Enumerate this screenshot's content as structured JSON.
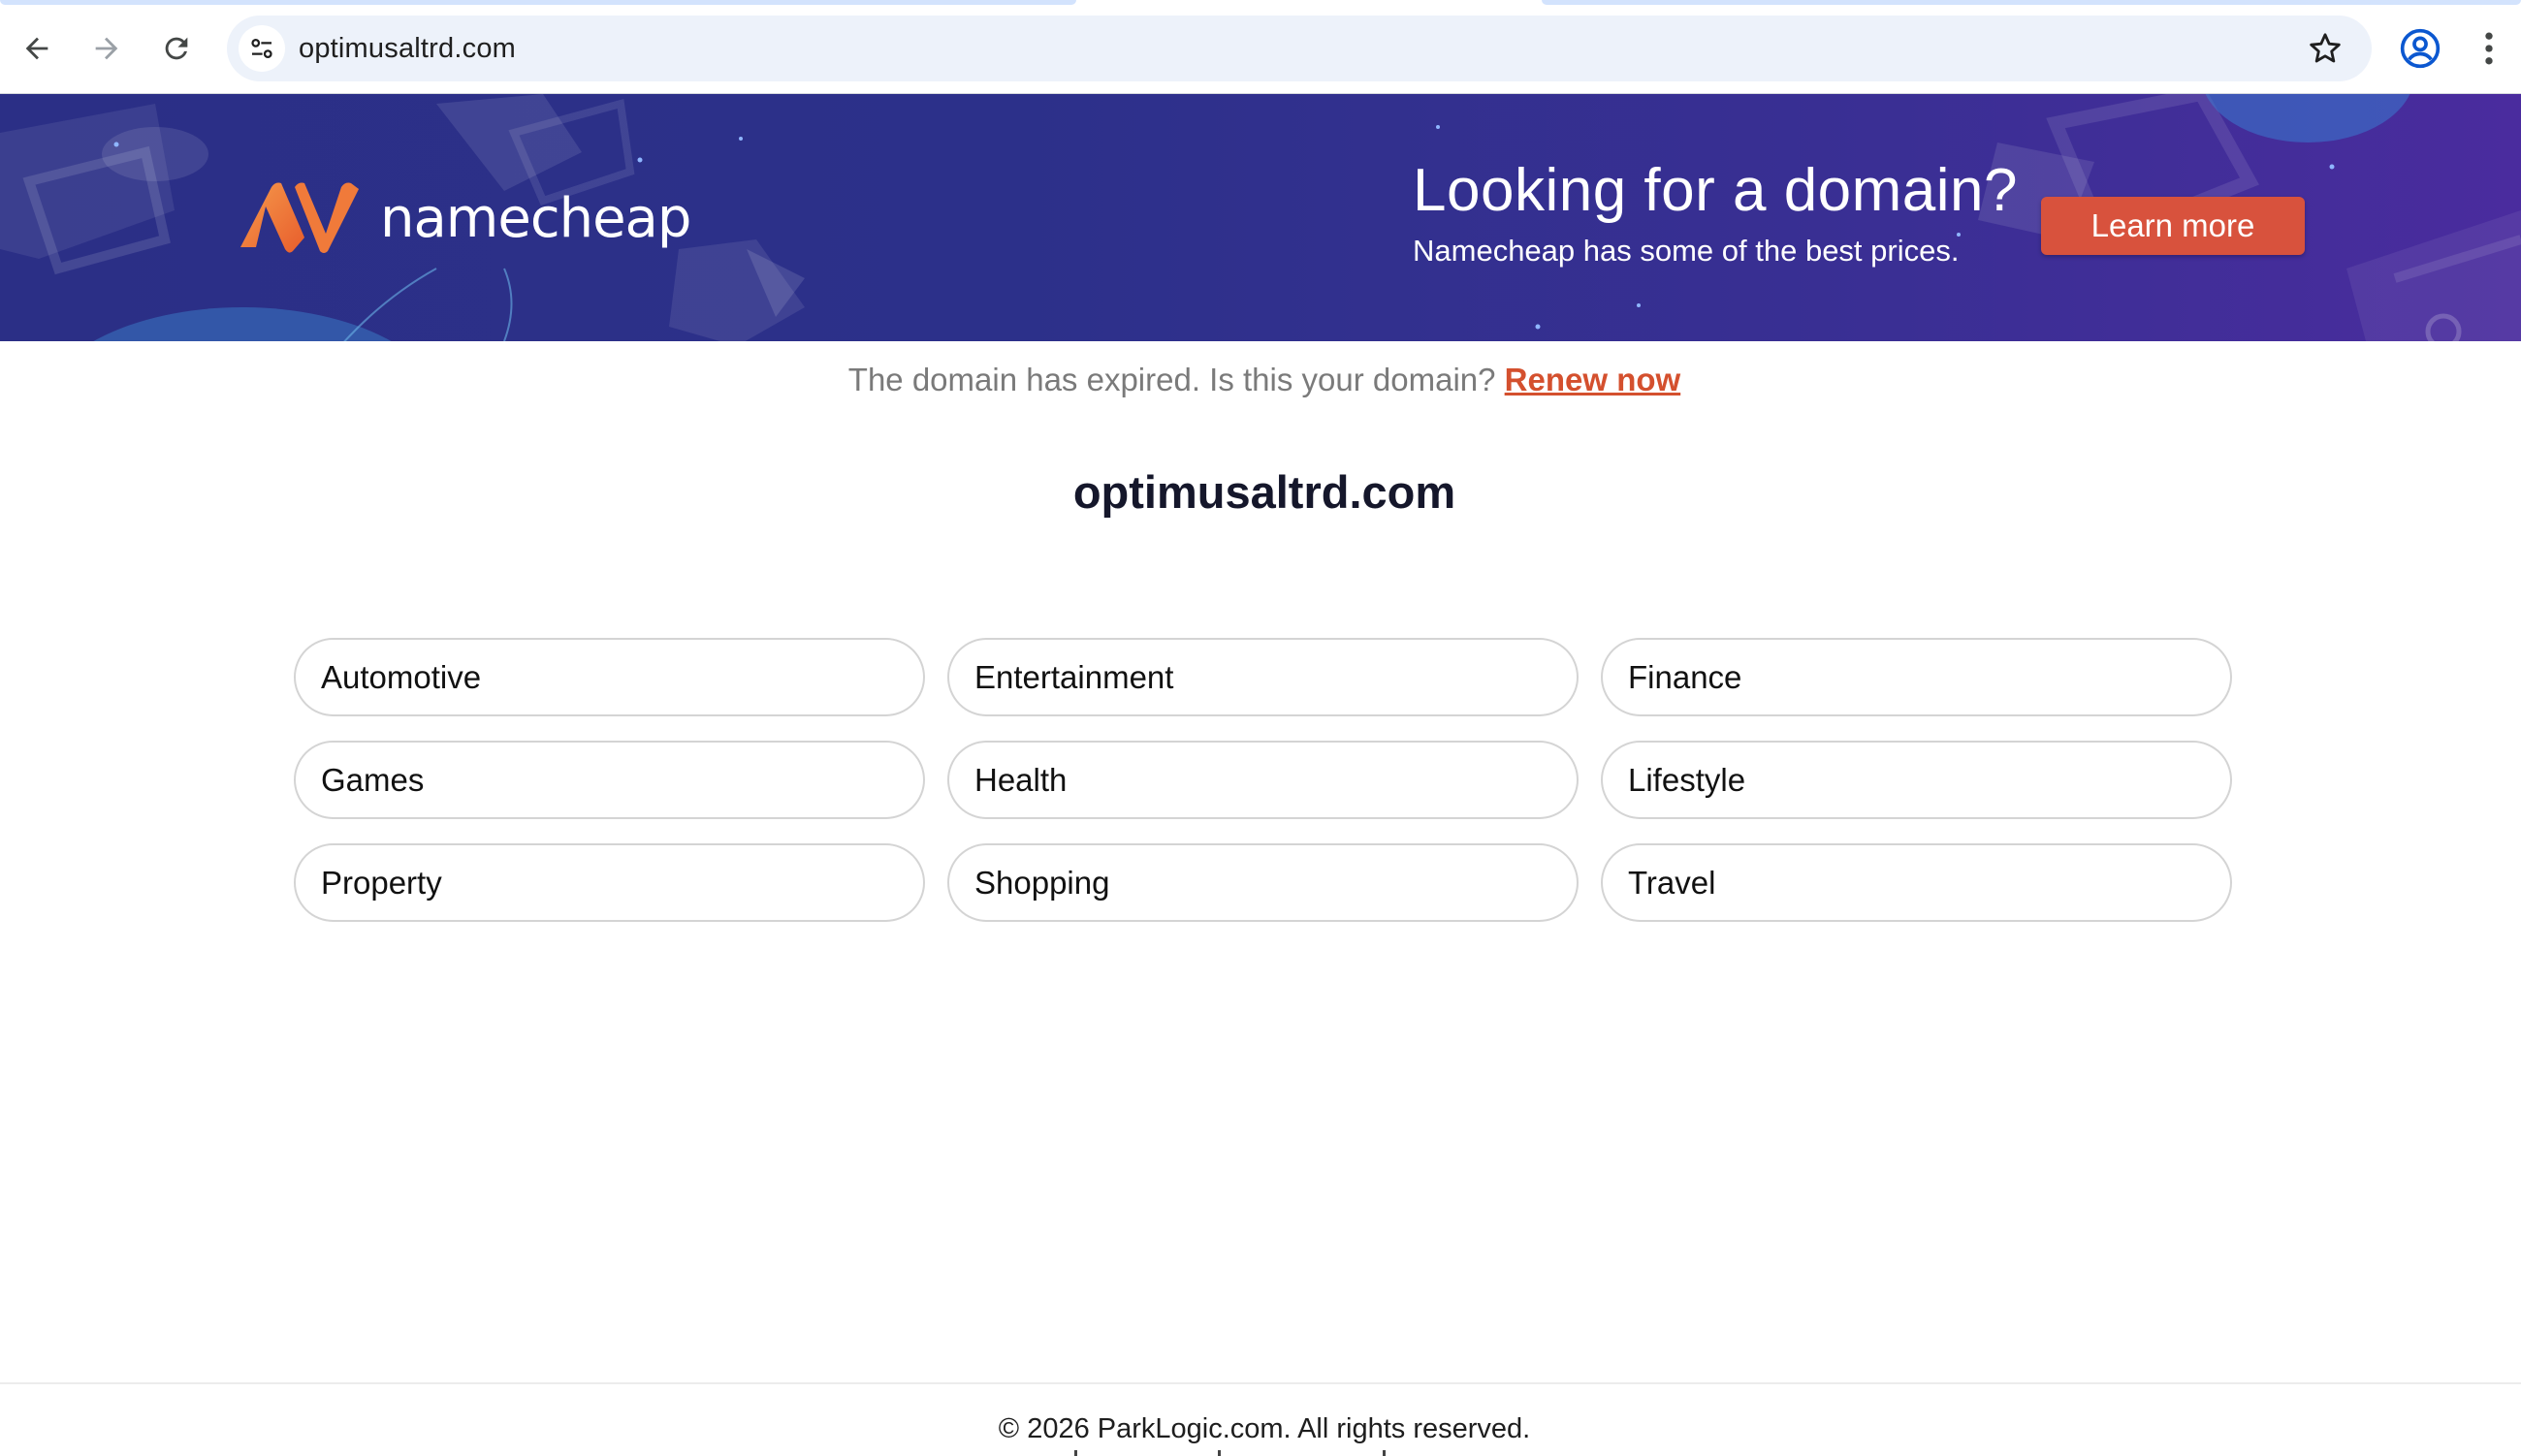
{
  "browser": {
    "url": "optimusaltrd.com",
    "icons": [
      "back-arrow-icon",
      "forward-arrow-icon",
      "reload-icon",
      "site-info-icon",
      "bookmark-star-icon",
      "profile-icon",
      "more-menu-icon"
    ]
  },
  "banner": {
    "brand_name": "namecheap",
    "title": "Looking for a domain?",
    "subtitle": "Namecheap has some of the best prices.",
    "cta_label": "Learn more",
    "colors": {
      "background": "#2c308a",
      "cta": "#d8523d",
      "logo_orange": "#f07a3a"
    }
  },
  "notice": {
    "text": "The domain has expired. Is this your domain?",
    "link_label": "Renew now",
    "link_color": "#d4502e"
  },
  "domain": "optimusaltrd.com",
  "categories": [
    "Automotive",
    "Entertainment",
    "Finance",
    "Games",
    "Health",
    "Lifestyle",
    "Property",
    "Shopping",
    "Travel"
  ],
  "footer": {
    "copyright": "© 2026 ParkLogic.com. All rights reserved."
  }
}
